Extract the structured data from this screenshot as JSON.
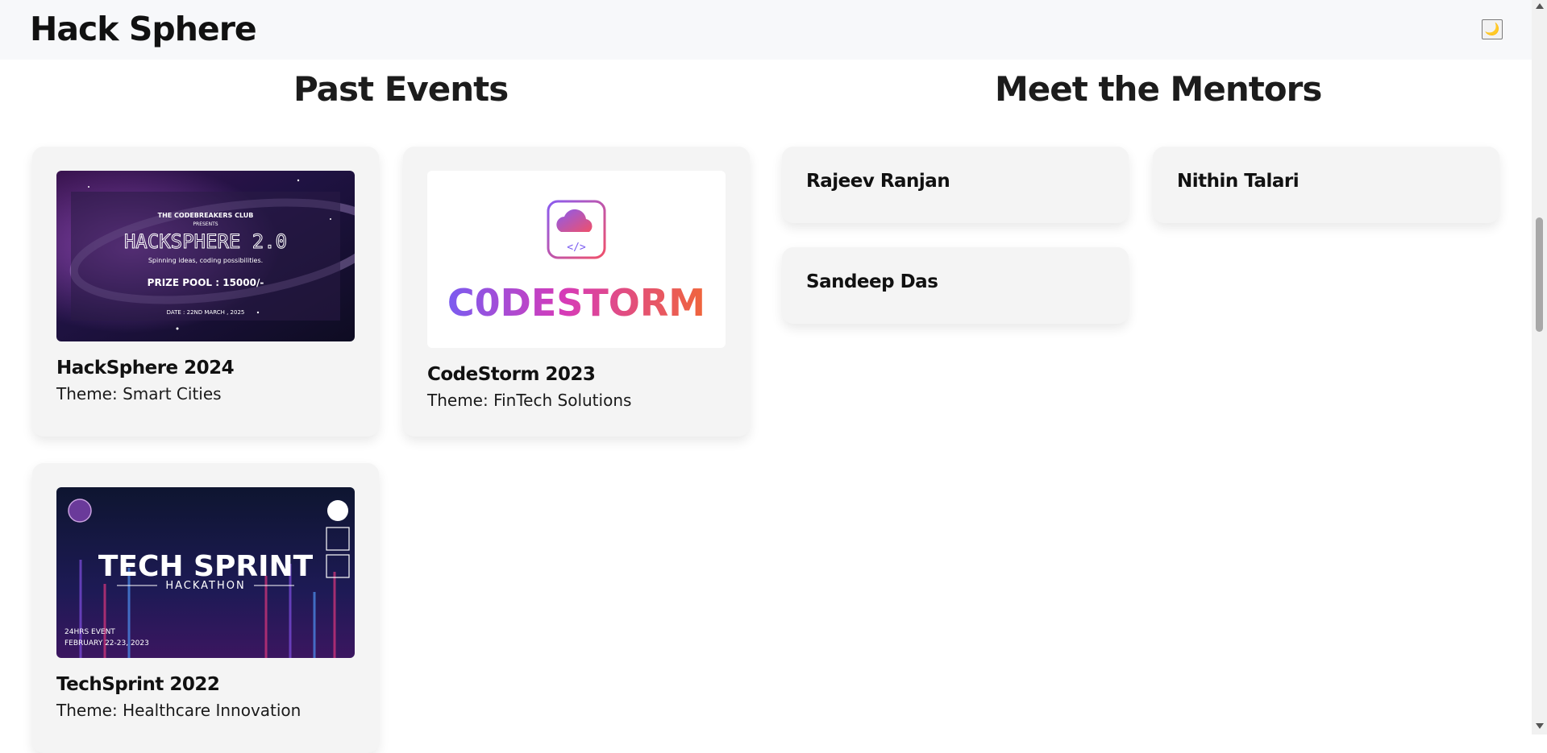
{
  "header": {
    "brand": "Hack Sphere",
    "theme_toggle_icon": "moon-icon"
  },
  "past_events": {
    "title": "Past Events",
    "events": [
      {
        "name": "HackSphere 2024",
        "theme": "Theme: Smart Cities",
        "banner": {
          "org": "THE CODEBREAKERS CLUB",
          "presents": "PRESENTS",
          "headline": "HACKSPHERE 2.0",
          "tagline": "Spinning ideas, coding possibilities.",
          "prize": "PRIZE POOL : 15000/-",
          "date": "DATE : 22ND MARCH , 2025"
        }
      },
      {
        "name": "CodeStorm 2023",
        "theme": "Theme: FinTech Solutions",
        "banner": {
          "logo_icon": "cloud-code-icon",
          "wordmark": "C0DESTORM"
        }
      },
      {
        "name": "TechSprint 2022",
        "theme": "Theme: Healthcare Innovation",
        "banner": {
          "headline": "TECH SPRINT",
          "subline": "HACKATHON",
          "event_length": "24HRS EVENT",
          "dates": "FEBRUARY 22-23, 2023"
        }
      }
    ]
  },
  "mentors": {
    "title": "Meet the Mentors",
    "list": [
      "Rajeev Ranjan",
      "Nithin Talari",
      "Sandeep Das"
    ]
  },
  "colors": {
    "header_bg": "#f7f8fa",
    "card_bg": "#f4f4f4",
    "text": "#111111"
  }
}
